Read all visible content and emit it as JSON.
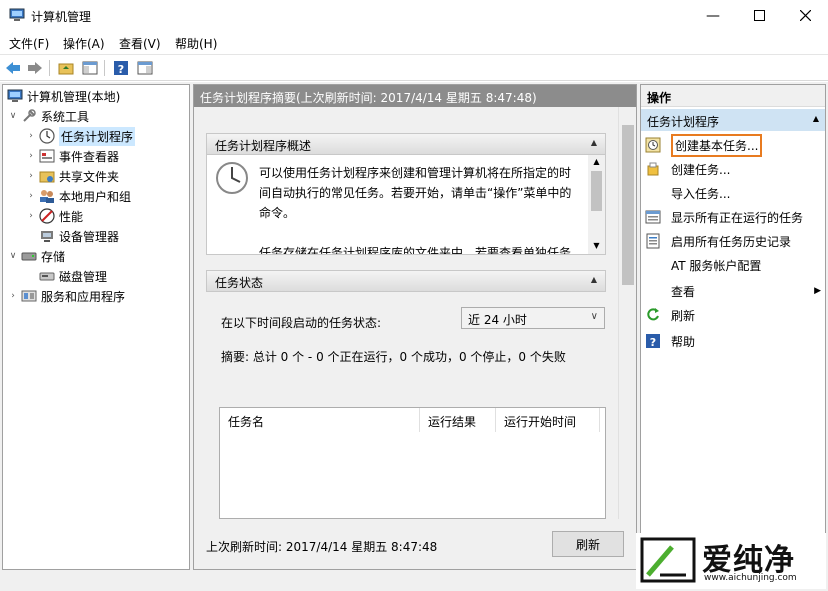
{
  "window": {
    "title": "计算机管理"
  },
  "menu": [
    "文件(F)",
    "操作(A)",
    "查看(V)",
    "帮助(H)"
  ],
  "tree": {
    "root": "计算机管理(本地)",
    "system_tools": "系统工具",
    "task_scheduler": "任务计划程序",
    "event_viewer": "事件查看器",
    "shared_folders": "共享文件夹",
    "local_users": "本地用户和组",
    "performance": "性能",
    "device_manager": "设备管理器",
    "storage": "存储",
    "disk_management": "磁盘管理",
    "services_apps": "服务和应用程序"
  },
  "center": {
    "summary_header": "任务计划程序摘要(上次刷新时间: 2017/4/14 星期五 8:47:48)",
    "overview": {
      "title": "任务计划程序概述",
      "text1": "可以使用任务计划程序来创建和管理计算机将在所指定的时间自动执行的常见任务。若要开始，请单击“操作”菜单中的命令。",
      "text2": "任务存储在任务计划程序库的文件夹中。若要查看单独任务上的操作或执行该操作，请在任务计划程序库中选择该任"
    },
    "status": {
      "title": "任务状态",
      "period_label": "在以下时间段启动的任务状态:",
      "period_value": "近 24 小时",
      "summary": "摘要: 总计 0 个 - 0 个正在运行，0 个成功，0 个停止，0 个失败"
    },
    "table_headers": [
      "任务名",
      "运行结果",
      "运行开始时间"
    ],
    "footer_last": "上次刷新时间: 2017/4/14 星期五 8:47:48",
    "refresh_button": "刷新"
  },
  "actions": {
    "title": "操作",
    "section": "任务计划程序",
    "items": [
      "创建基本任务...",
      "创建任务...",
      "导入任务...",
      "显示所有正在运行的任务",
      "启用所有任务历史记录",
      "AT 服务帐户配置",
      "查看",
      "刷新",
      "帮助"
    ]
  },
  "watermark": {
    "brand": "爱纯净",
    "url": "www.aichunjing.com"
  },
  "colors": {
    "highlight_border": "#e87b20",
    "selection": "#cce8ff",
    "actions_section": "#cfe3f3",
    "header_gray": "#8c8c8c"
  }
}
